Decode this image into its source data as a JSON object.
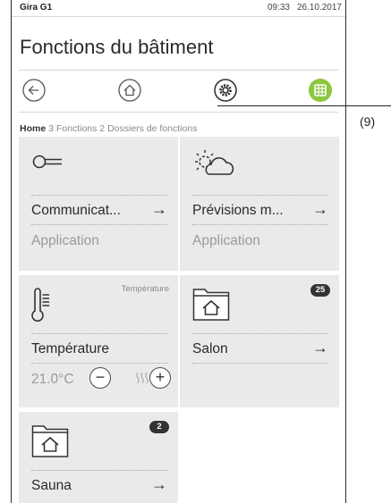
{
  "status_bar": {
    "brand": "Gira G1",
    "time": "09:33",
    "date": "26.10.2017"
  },
  "page": {
    "title": "Fonctions du bâtiment"
  },
  "nav": {
    "icons": [
      "back-icon",
      "home-icon",
      "settings-icon",
      "favorites-icon"
    ],
    "favorites_color": "#8dc63f"
  },
  "breadcrumb": {
    "home": "Home",
    "rest": "3 Fonctions 2 Dossiers de fonctions"
  },
  "tiles": [
    {
      "icon": "key-icon",
      "name": "Communicat...",
      "subtitle": "Application"
    },
    {
      "icon": "weather-icon",
      "name": "Prévisions m...",
      "subtitle": "Application"
    },
    {
      "icon": "thermometer-icon",
      "caption": "Température",
      "name": "Température",
      "value": "21.0°C"
    },
    {
      "icon": "folder-home-icon",
      "badge": "25",
      "name": "Salon"
    },
    {
      "icon": "folder-home-icon",
      "badge": "2",
      "name": "Sauna"
    }
  ],
  "controls": {
    "minus": "−",
    "plus": "+",
    "arrow": "→"
  },
  "callout": {
    "label": "(9)"
  }
}
